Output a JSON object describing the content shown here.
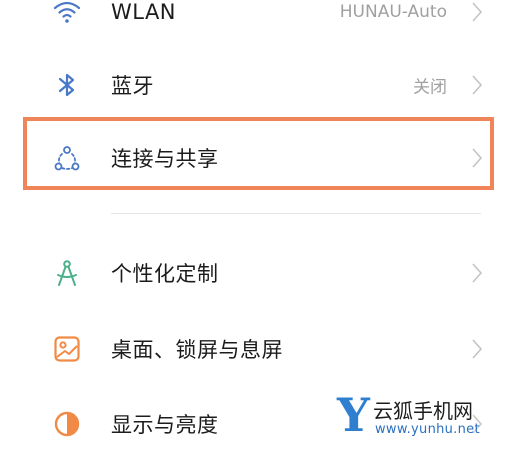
{
  "settings": {
    "items": [
      {
        "label": "WLAN",
        "value": "HUNAU-Auto",
        "icon": "wifi-icon"
      },
      {
        "label": "蓝牙",
        "value": "关闭",
        "icon": "bluetooth-icon"
      },
      {
        "label": "连接与共享",
        "value": "",
        "icon": "connection-share-icon"
      },
      {
        "label": "个性化定制",
        "value": "",
        "icon": "compass-icon"
      },
      {
        "label": "桌面、锁屏与息屏",
        "value": "",
        "icon": "wallpaper-icon"
      },
      {
        "label": "显示与亮度",
        "value": "",
        "icon": "brightness-icon"
      }
    ]
  },
  "highlight": {
    "color": "#ef8559",
    "target": "连接与共享"
  },
  "colors": {
    "icon_blue": "#4a78c8",
    "icon_green": "#4cb08a",
    "icon_orange": "#f08a44",
    "text": "#1c1c1c",
    "secondary": "#a0a0a0"
  },
  "watermark": {
    "letter": "Y",
    "brand": "云狐手机网",
    "url": "www.yunhu.net"
  }
}
